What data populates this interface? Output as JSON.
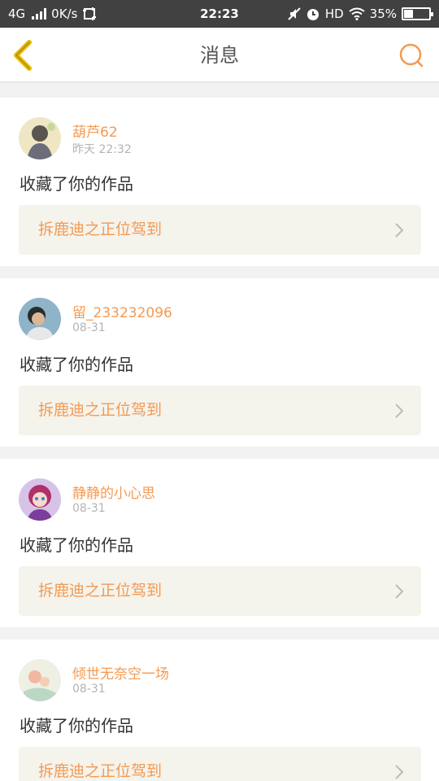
{
  "status_bar": {
    "network": "4G",
    "speed": "0K/s",
    "time": "22:23",
    "hd": "HD",
    "battery": "35%",
    "battery_level": 0.35
  },
  "header": {
    "title": "消息"
  },
  "notifications": [
    {
      "user": "葫芦62",
      "time": "昨天 22:32",
      "action": "收藏了你的作品",
      "work_title": "拆鹿迪之正位驾到"
    },
    {
      "user": "留_233232096",
      "time": "08-31",
      "action": "收藏了你的作品",
      "work_title": "拆鹿迪之正位驾到"
    },
    {
      "user": "静静的小心思",
      "time": "08-31",
      "action": "收藏了你的作品",
      "work_title": "拆鹿迪之正位驾到"
    },
    {
      "user": "倾世无奈空一场",
      "time": "08-31",
      "action": "收藏了你的作品",
      "work_title": "拆鹿迪之正位驾到"
    }
  ],
  "colors": {
    "accent": "#f39a52",
    "back_arrow": "#e8b800",
    "statusbar": "#414141"
  }
}
